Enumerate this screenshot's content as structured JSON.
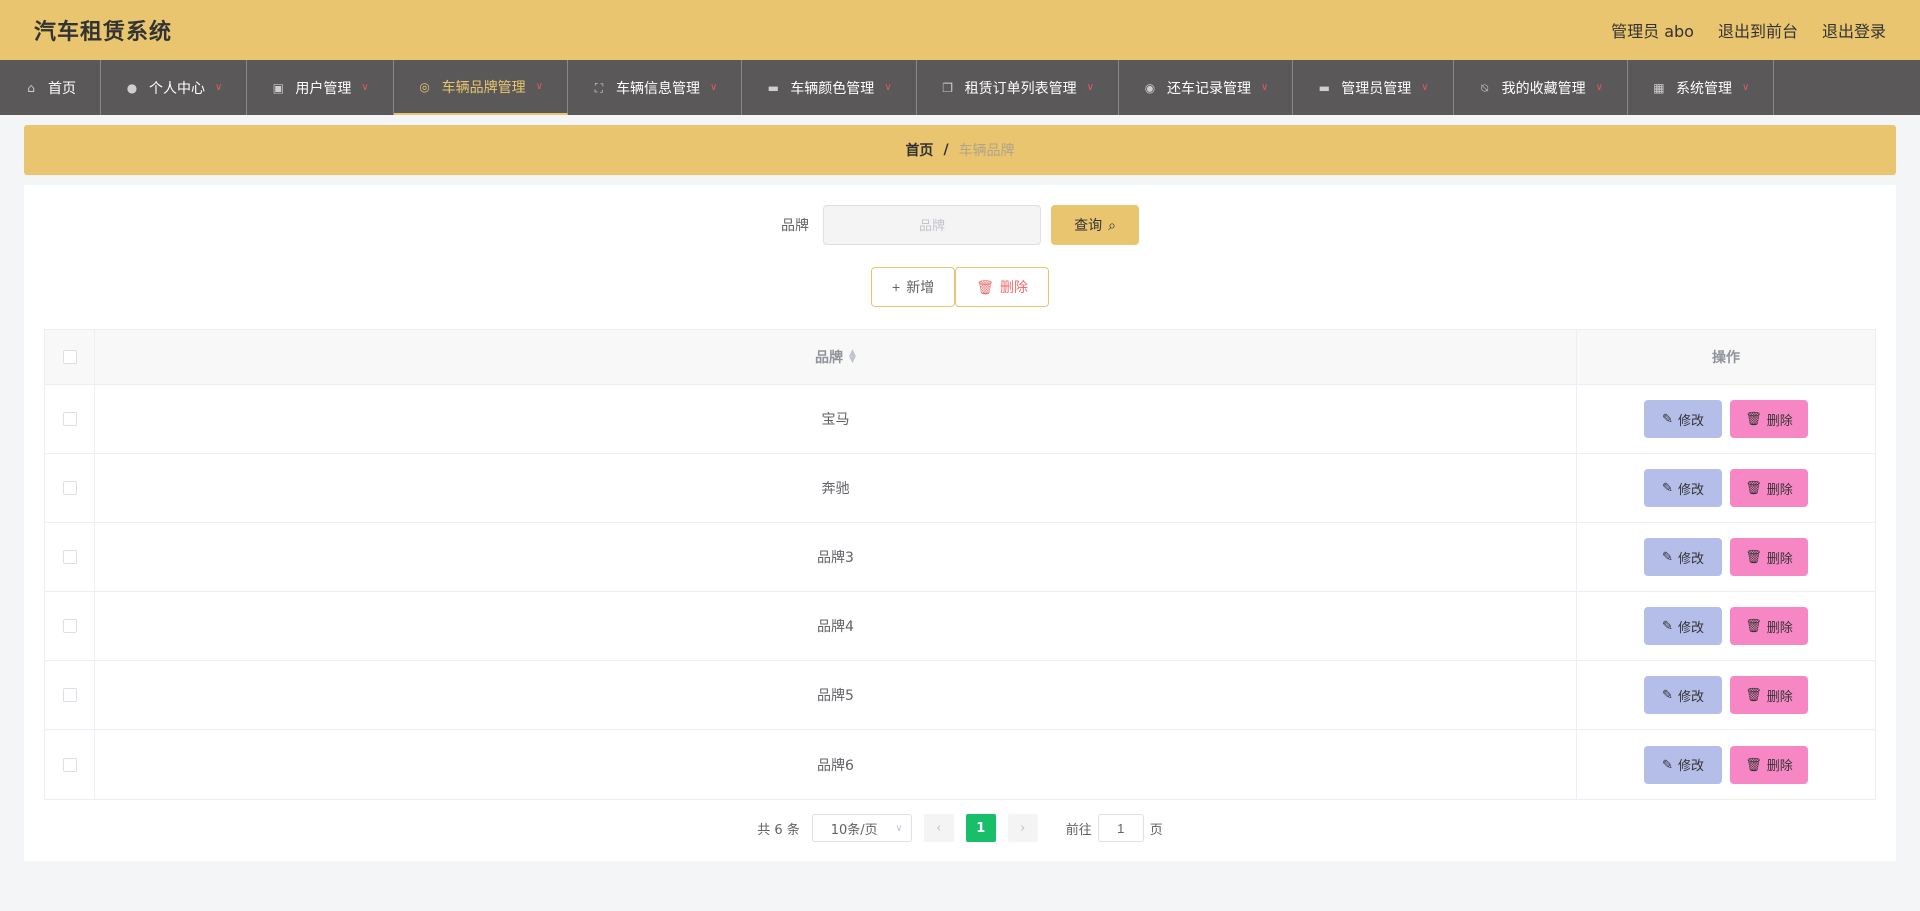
{
  "header": {
    "title": "汽车租赁系统",
    "user_label": "管理员 abo",
    "to_front_label": "退出到前台",
    "logout_label": "退出登录"
  },
  "nav": {
    "items": [
      {
        "label": "首页",
        "icon": "home-icon",
        "has_dropdown": false,
        "active": false
      },
      {
        "label": "个人中心",
        "icon": "user-icon",
        "has_dropdown": true,
        "active": false
      },
      {
        "label": "用户管理",
        "icon": "user-manage-icon",
        "has_dropdown": true,
        "active": false
      },
      {
        "label": "车辆品牌管理",
        "icon": "brand-icon",
        "has_dropdown": true,
        "active": true
      },
      {
        "label": "车辆信息管理",
        "icon": "fullscreen-icon",
        "has_dropdown": true,
        "active": false
      },
      {
        "label": "车辆颜色管理",
        "icon": "monitor-icon",
        "has_dropdown": true,
        "active": false
      },
      {
        "label": "租赁订单列表管理",
        "icon": "copy-icon",
        "has_dropdown": true,
        "active": false
      },
      {
        "label": "还车记录管理",
        "icon": "lifebuoy-icon",
        "has_dropdown": true,
        "active": false
      },
      {
        "label": "管理员管理",
        "icon": "monitor-icon",
        "has_dropdown": true,
        "active": false
      },
      {
        "label": "我的收藏管理",
        "icon": "bell-off-icon",
        "has_dropdown": true,
        "active": false
      },
      {
        "label": "系统管理",
        "icon": "grid-icon",
        "has_dropdown": true,
        "active": false
      }
    ]
  },
  "breadcrumb": {
    "home": "首页",
    "separator": "/",
    "current": "车辆品牌"
  },
  "search": {
    "label": "品牌",
    "placeholder": "品牌",
    "value": "",
    "query_label": "查询"
  },
  "actions": {
    "add_label": "新增",
    "delete_label": "删除"
  },
  "table": {
    "columns": {
      "brand": "品牌",
      "operation": "操作"
    },
    "rows": [
      {
        "brand": "宝马"
      },
      {
        "brand": "奔驰"
      },
      {
        "brand": "品牌3"
      },
      {
        "brand": "品牌4"
      },
      {
        "brand": "品牌5"
      },
      {
        "brand": "品牌6"
      }
    ],
    "edit_label": "修改",
    "delete_label": "删除"
  },
  "pagination": {
    "total_text": "共 6 条",
    "page_size": "10条/页",
    "current_page": "1",
    "goto_label": "前往",
    "goto_value": "1",
    "page_unit": "页"
  },
  "colors": {
    "primary": "#e8c56e",
    "nav_bg": "#5a5859",
    "edit_btn": "#b4bee8",
    "delete_btn": "#f787c4",
    "active_page": "#19be6b"
  }
}
